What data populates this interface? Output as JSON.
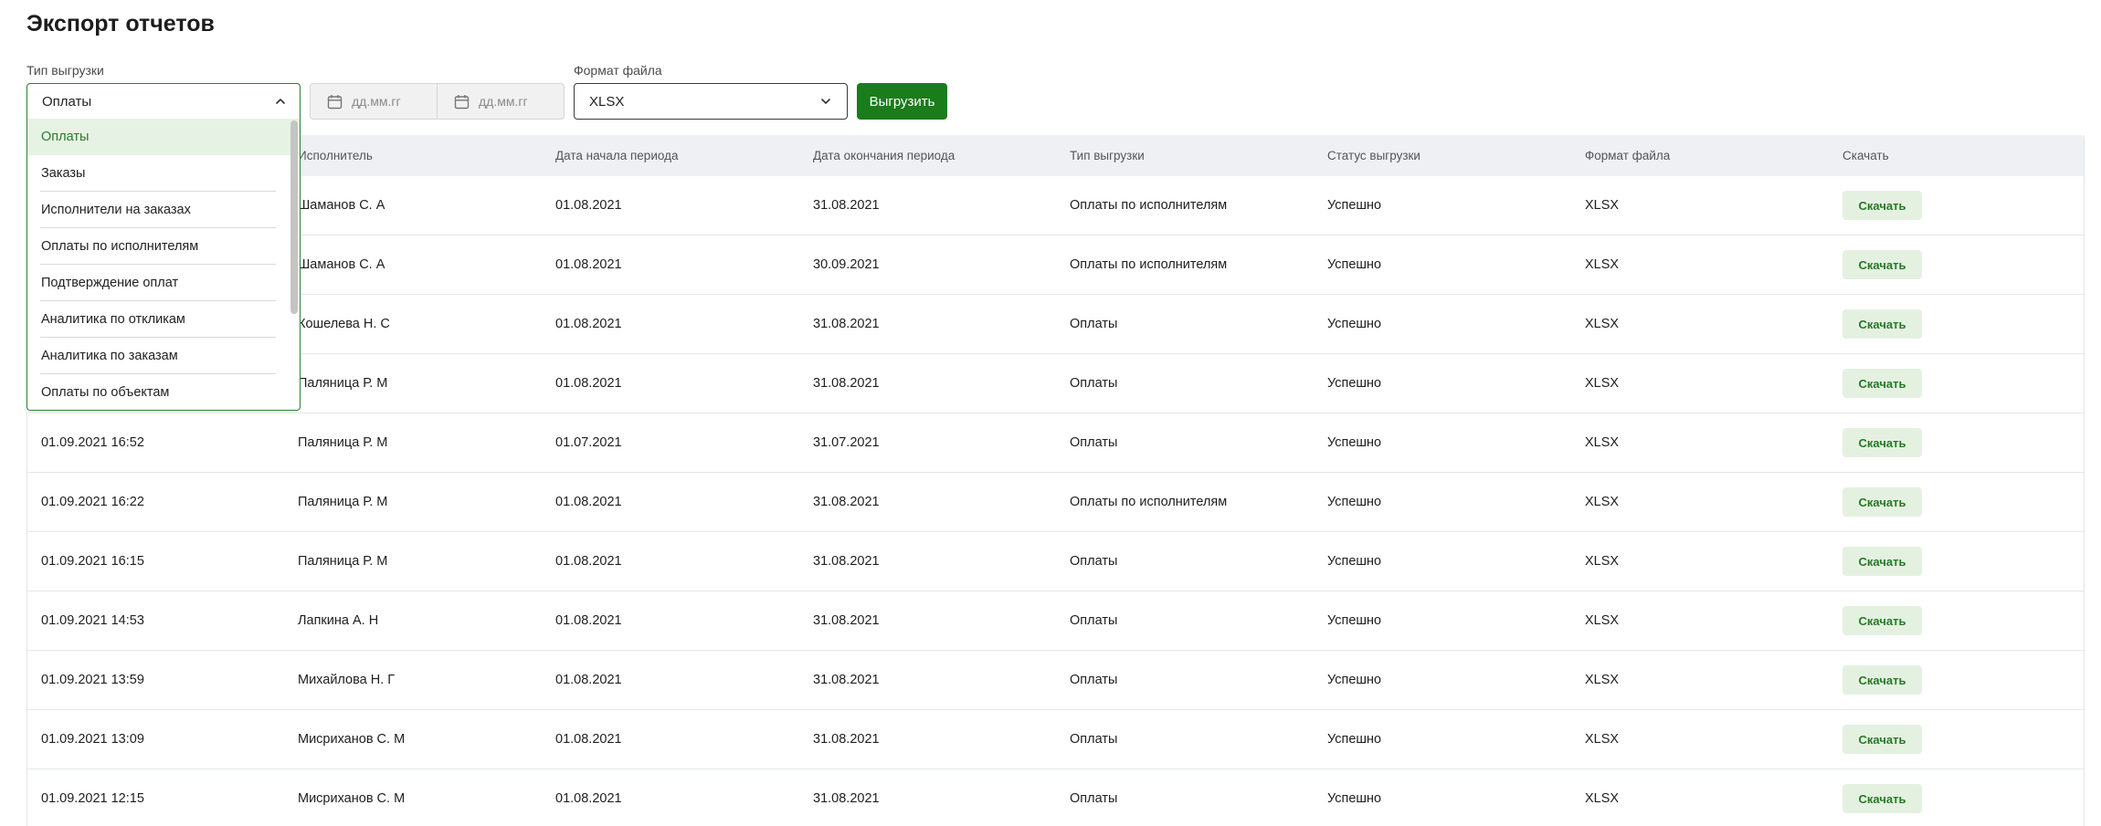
{
  "page": {
    "title": "Экспорт отчетов"
  },
  "filters": {
    "type_label": "Тип выгрузки",
    "type_value": "Оплаты",
    "type_options": [
      "Оплаты",
      "Заказы",
      "Исполнители на заказах",
      "Оплаты по исполнителям",
      "Подтверждение оплат",
      "Аналитика по откликам",
      "Аналитика по заказам",
      "Оплаты по объектам"
    ],
    "date_from_placeholder": "дд.мм.гг",
    "date_to_placeholder": "дд.мм.гг",
    "format_label": "Формат файла",
    "format_value": "XLSX",
    "export_button": "Выгрузить"
  },
  "table": {
    "columns": [
      "",
      "Исполнитель",
      "Дата начала периода",
      "Дата окончания периода",
      "Тип выгрузки",
      "Статус выгрузки",
      "Формат файла",
      "Скачать"
    ],
    "rows": [
      {
        "created": "",
        "executor": "Шаманов С. А",
        "start": "01.08.2021",
        "end": "31.08.2021",
        "type": "Оплаты по исполнителям",
        "status": "Успешно",
        "format": "XLSX",
        "action": "Скачать"
      },
      {
        "created": "",
        "executor": "Шаманов С. А",
        "start": "01.08.2021",
        "end": "30.09.2021",
        "type": "Оплаты по исполнителям",
        "status": "Успешно",
        "format": "XLSX",
        "action": "Скачать"
      },
      {
        "created": "",
        "executor": "Кошелева Н. С",
        "start": "01.08.2021",
        "end": "31.08.2021",
        "type": "Оплаты",
        "status": "Успешно",
        "format": "XLSX",
        "action": "Скачать"
      },
      {
        "created": "",
        "executor": "Паляница Р. М",
        "start": "01.08.2021",
        "end": "31.08.2021",
        "type": "Оплаты",
        "status": "Успешно",
        "format": "XLSX",
        "action": "Скачать"
      },
      {
        "created": "01.09.2021 16:52",
        "executor": "Паляница Р. М",
        "start": "01.07.2021",
        "end": "31.07.2021",
        "type": "Оплаты",
        "status": "Успешно",
        "format": "XLSX",
        "action": "Скачать"
      },
      {
        "created": "01.09.2021 16:22",
        "executor": "Паляница Р. М",
        "start": "01.08.2021",
        "end": "31.08.2021",
        "type": "Оплаты по исполнителям",
        "status": "Успешно",
        "format": "XLSX",
        "action": "Скачать"
      },
      {
        "created": "01.09.2021 16:15",
        "executor": "Паляница Р. М",
        "start": "01.08.2021",
        "end": "31.08.2021",
        "type": "Оплаты",
        "status": "Успешно",
        "format": "XLSX",
        "action": "Скачать"
      },
      {
        "created": "01.09.2021 14:53",
        "executor": "Лапкина А. Н",
        "start": "01.08.2021",
        "end": "31.08.2021",
        "type": "Оплаты",
        "status": "Успешно",
        "format": "XLSX",
        "action": "Скачать"
      },
      {
        "created": "01.09.2021 13:59",
        "executor": "Михайлова Н. Г",
        "start": "01.08.2021",
        "end": "31.08.2021",
        "type": "Оплаты",
        "status": "Успешно",
        "format": "XLSX",
        "action": "Скачать"
      },
      {
        "created": "01.09.2021 13:09",
        "executor": "Мисриханов С. М",
        "start": "01.08.2021",
        "end": "31.08.2021",
        "type": "Оплаты",
        "status": "Успешно",
        "format": "XLSX",
        "action": "Скачать"
      },
      {
        "created": "01.09.2021 12:15",
        "executor": "Мисриханов С. М",
        "start": "01.08.2021",
        "end": "31.08.2021",
        "type": "Оплаты",
        "status": "Успешно",
        "format": "XLSX",
        "action": "Скачать"
      }
    ]
  },
  "icons": {
    "type_chevron": "chevron-up-icon",
    "format_chevron": "chevron-down-icon",
    "date_icon": "calendar-icon"
  },
  "colors": {
    "primary": "#1a7c1a",
    "selected_bg": "#e6f3e4",
    "header_bg": "#eef0f4"
  }
}
